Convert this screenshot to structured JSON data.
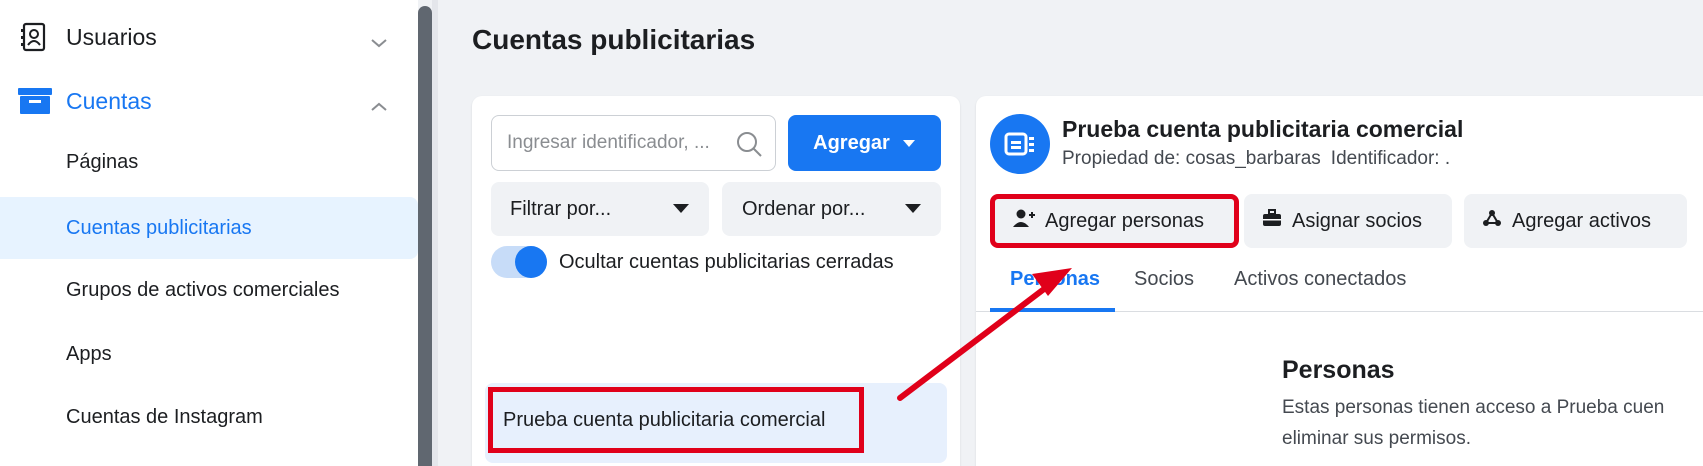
{
  "sidebar": {
    "usuarios_label": "Usuarios",
    "cuentas_label": "Cuentas",
    "items": [
      {
        "label": "Páginas"
      },
      {
        "label": "Cuentas publicitarias"
      },
      {
        "label": "Grupos de activos comerciales"
      },
      {
        "label": "Apps"
      },
      {
        "label": "Cuentas de Instagram"
      }
    ],
    "active_item": "Cuentas publicitarias"
  },
  "page": {
    "title": "Cuentas publicitarias"
  },
  "left_panel": {
    "search_placeholder": "Ingresar identificador, ...",
    "add_button_label": "Agregar",
    "filter_label": "Filtrar por...",
    "sort_label": "Ordenar por...",
    "toggle_label": "Ocultar cuentas publicitarias cerradas",
    "toggle_on": true,
    "accounts": [
      {
        "name": "Prueba cuenta publicitaria comercial"
      }
    ]
  },
  "right_panel": {
    "account_name": "Prueba cuenta publicitaria comercial",
    "owner": "Propiedad de: cosas_barbaras",
    "identifier": "Identificador: .",
    "actions": [
      {
        "label": "Agregar personas",
        "icon": "add-person-icon"
      },
      {
        "label": "Asignar socios",
        "icon": "briefcase-icon"
      },
      {
        "label": "Agregar activos",
        "icon": "assets-icon"
      }
    ],
    "tabs": [
      {
        "label": "Personas"
      },
      {
        "label": "Socios"
      },
      {
        "label": "Activos conectados"
      }
    ],
    "active_tab": "Personas",
    "section_title": "Personas",
    "section_desc_line1": "Estas personas tienen acceso a Prueba cuen",
    "section_desc_line2": "eliminar sus permisos."
  },
  "colors": {
    "accent": "#1877f2",
    "highlight_box": "#e0001a",
    "active_bg": "#e7f3ff"
  }
}
